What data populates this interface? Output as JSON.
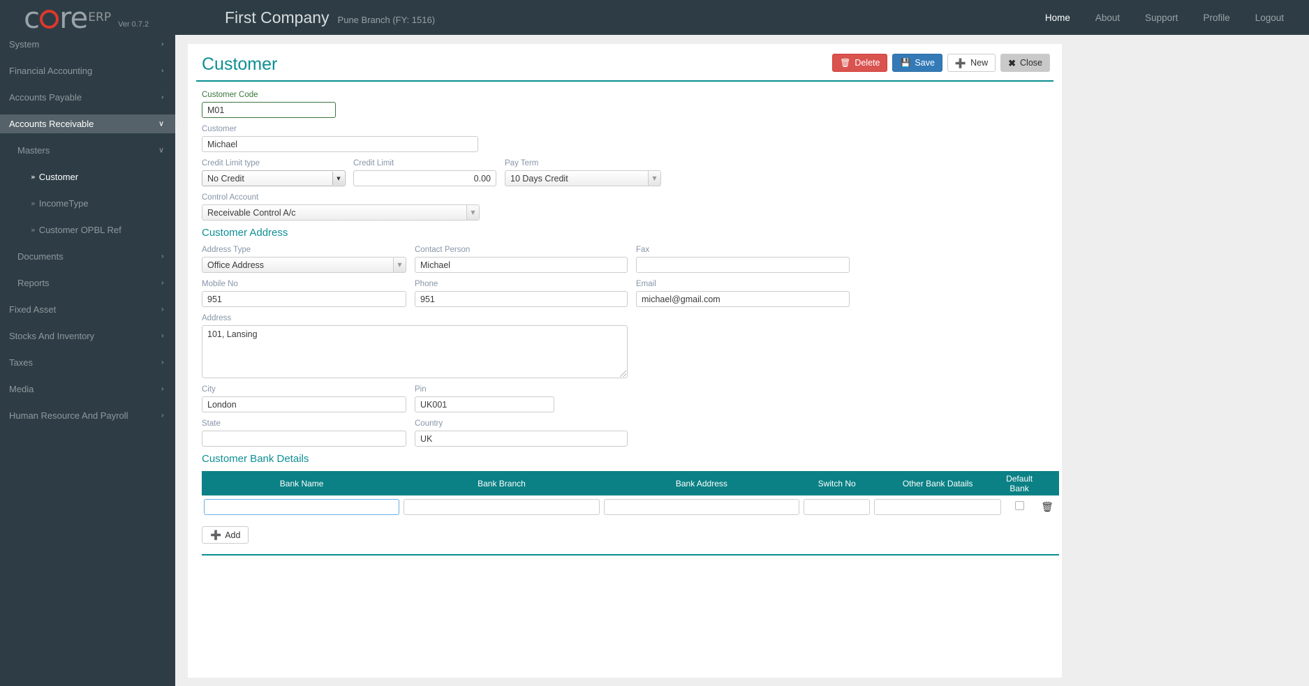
{
  "navbar": {
    "logo": {
      "text_left": "c",
      "text_o": "o",
      "text_right": "re",
      "suffix": "ERP",
      "version": "Ver 0.7.2"
    },
    "company": "First Company",
    "branch": "Pune Branch (FY: 1516)",
    "links": [
      {
        "label": "Home",
        "active": true
      },
      {
        "label": "About",
        "active": false
      },
      {
        "label": "Support",
        "active": false
      },
      {
        "label": "Profile",
        "active": false
      },
      {
        "label": "Logout",
        "active": false
      }
    ]
  },
  "sidebar": {
    "items": [
      {
        "label": "System",
        "level": 0,
        "caret": "›",
        "state": ""
      },
      {
        "label": "Financial Accounting",
        "level": 0,
        "caret": "›",
        "state": ""
      },
      {
        "label": "Accounts Payable",
        "level": 0,
        "caret": "›",
        "state": ""
      },
      {
        "label": "Accounts Receivable",
        "level": 0,
        "caret": "∨",
        "state": "active-branch"
      },
      {
        "label": "Masters",
        "level": 1,
        "caret": "∨",
        "state": ""
      },
      {
        "label": "Customer",
        "level": 2,
        "caret": "",
        "state": "active-leaf",
        "bullet": "»"
      },
      {
        "label": "IncomeType",
        "level": 2,
        "caret": "",
        "state": "",
        "bullet": "»"
      },
      {
        "label": "Customer OPBL Ref",
        "level": 2,
        "caret": "",
        "state": "",
        "bullet": "»"
      },
      {
        "label": "Documents",
        "level": 1,
        "caret": "›",
        "state": ""
      },
      {
        "label": "Reports",
        "level": 1,
        "caret": "›",
        "state": ""
      },
      {
        "label": "Fixed Asset",
        "level": 0,
        "caret": "›",
        "state": ""
      },
      {
        "label": "Stocks And Inventory",
        "level": 0,
        "caret": "›",
        "state": ""
      },
      {
        "label": "Taxes",
        "level": 0,
        "caret": "›",
        "state": ""
      },
      {
        "label": "Media",
        "level": 0,
        "caret": "›",
        "state": ""
      },
      {
        "label": "Human Resource And Payroll",
        "level": 0,
        "caret": "›",
        "state": ""
      }
    ]
  },
  "page": {
    "title": "Customer",
    "buttons": {
      "delete": {
        "label": "Delete",
        "icon": "trash-icon",
        "glyph": "🗑",
        "color": "#d9534f"
      },
      "save": {
        "label": "Save",
        "icon": "floppy-disk-icon",
        "glyph": "💾",
        "color": "#337ab7"
      },
      "new": {
        "label": "New",
        "icon": "plus-icon",
        "glyph": "➕",
        "color": "#ffffff"
      },
      "close": {
        "label": "Close",
        "icon": "times-icon",
        "glyph": "✖",
        "color": "#c9c9c9"
      }
    }
  },
  "form": {
    "customer_code": {
      "label": "Customer Code",
      "value": "M01"
    },
    "customer": {
      "label": "Customer",
      "value": "Michael"
    },
    "credit_limit_type": {
      "label": "Credit Limit type",
      "value": "No Credit"
    },
    "credit_limit": {
      "label": "Credit Limit",
      "value": "0.00"
    },
    "pay_term": {
      "label": "Pay Term",
      "value": "10 Days Credit"
    },
    "control_account": {
      "label": "Control Account",
      "value": "Receivable Control A/c"
    }
  },
  "address": {
    "section_title": "Customer Address",
    "address_type": {
      "label": "Address Type",
      "value": "Office Address"
    },
    "contact_person": {
      "label": "Contact Person",
      "value": "Michael"
    },
    "fax": {
      "label": "Fax",
      "value": ""
    },
    "mobile_no": {
      "label": "Mobile No",
      "value": "951"
    },
    "phone": {
      "label": "Phone",
      "value": "951"
    },
    "email": {
      "label": "Email",
      "value": "michael@gmail.com"
    },
    "address": {
      "label": "Address",
      "value": "101, Lansing"
    },
    "city": {
      "label": "City",
      "value": "London"
    },
    "pin": {
      "label": "Pin",
      "value": "UK001"
    },
    "state": {
      "label": "State",
      "value": ""
    },
    "country": {
      "label": "Country",
      "value": "UK"
    }
  },
  "bank": {
    "section_title": "Customer Bank Details",
    "headers": {
      "bank_name": "Bank Name",
      "bank_branch": "Bank Branch",
      "bank_address": "Bank Address",
      "switch_no": "Switch No",
      "other_bank_details": "Other Bank Datails",
      "default_bank_line1": "Default",
      "default_bank_line2": "Bank"
    },
    "rows": [
      {
        "bank_name": "",
        "bank_branch": "",
        "bank_address": "",
        "switch_no": "",
        "other": "",
        "default_checked": false
      }
    ],
    "add_button": {
      "label": "Add",
      "icon": "plus-icon",
      "glyph": "➕"
    },
    "delete_row_icon": "🗑",
    "header_color": "#0b8185"
  },
  "theme": {
    "navbar_bg": "#2e3d45",
    "accent_teal": "#0e8f93",
    "primary_blue": "#337ab7",
    "danger_red": "#d9534f",
    "valid_green": "#3c763d"
  }
}
